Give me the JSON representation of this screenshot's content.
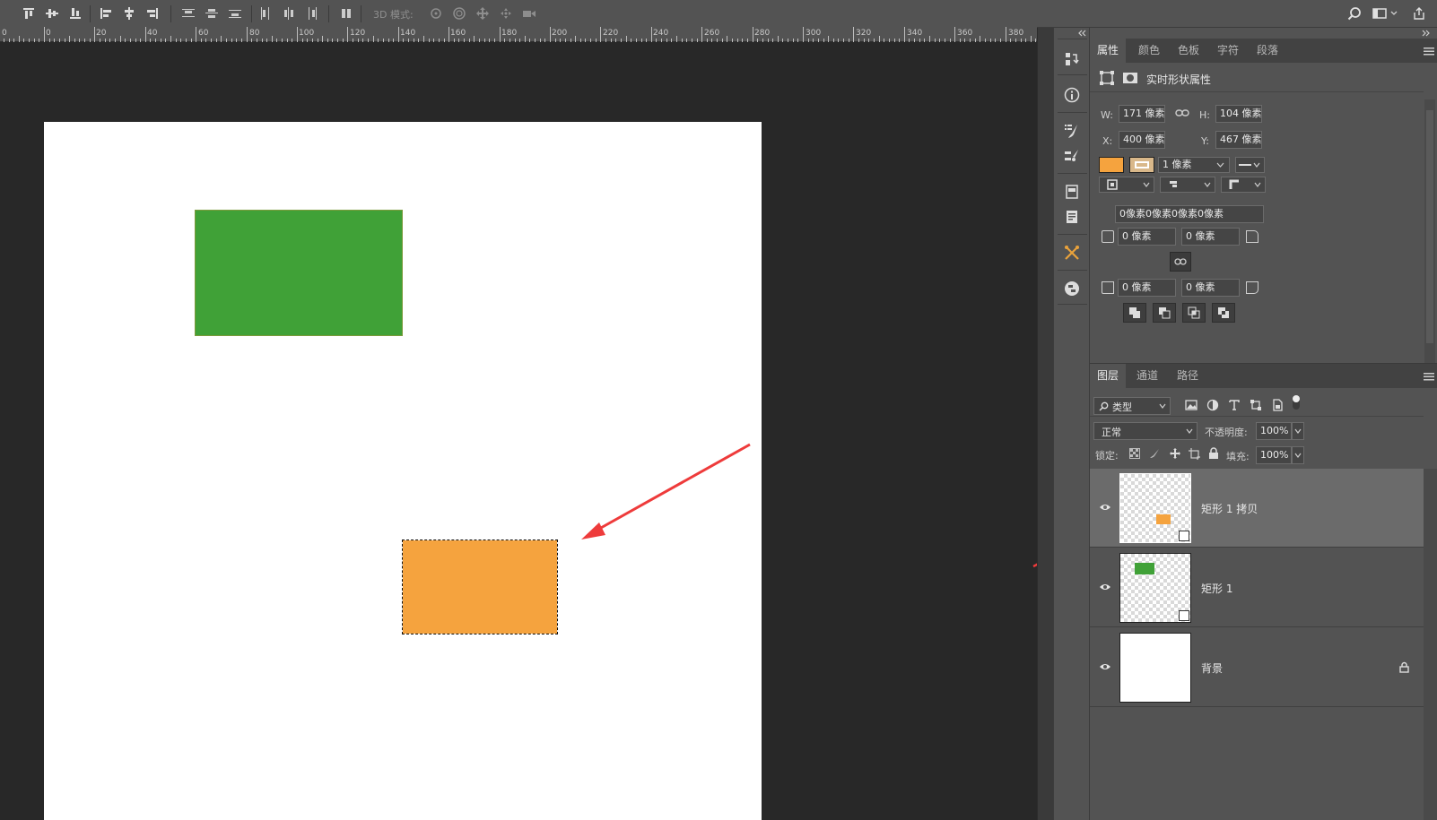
{
  "options_bar": {
    "mode_label": "3D 模式:"
  },
  "ruler": {
    "ticks": [
      "0",
      "20",
      "40",
      "60",
      "80",
      "100",
      "120",
      "140",
      "160",
      "180",
      "200",
      "220",
      "240",
      "260",
      "280",
      "300",
      "320",
      "340",
      "360",
      "380"
    ]
  },
  "properties_panel": {
    "tabs": [
      "属性",
      "颜色",
      "色板",
      "字符",
      "段落"
    ],
    "active_tab": "属性",
    "header_title": "实时形状属性",
    "w_label": "W:",
    "w_value": "171 像素",
    "h_label": "H:",
    "h_value": "104 像素",
    "x_label": "X:",
    "x_value": "400 像素",
    "y_label": "Y:",
    "y_value": "467 像素",
    "fill_color": "#f5a33e",
    "stroke_width": "1 像素",
    "corner_all": "0像素0像素0像素0像素",
    "corner_tl": "0 像素",
    "corner_tr": "0 像素",
    "corner_bl": "0 像素",
    "corner_br": "0 像素"
  },
  "layers_panel": {
    "tabs": [
      "图层",
      "通道",
      "路径"
    ],
    "active_tab": "图层",
    "filter_label": "类型",
    "blend_mode": "正常",
    "opacity_label": "不透明度:",
    "opacity_value": "100%",
    "lock_label": "锁定:",
    "fill_label": "填充:",
    "fill_value": "100%",
    "layers": [
      {
        "name": "矩形 1 拷贝",
        "selected": true,
        "thumb_color": "#f5a33e"
      },
      {
        "name": "矩形 1",
        "selected": false,
        "thumb_color": "#40a137"
      },
      {
        "name": "背景",
        "selected": false,
        "thumb_color": "#ffffff"
      }
    ]
  },
  "canvas": {
    "green_rect_color": "#40a137",
    "orange_rect_color": "#f5a33e",
    "arrow_color": "#ee3b3b"
  }
}
